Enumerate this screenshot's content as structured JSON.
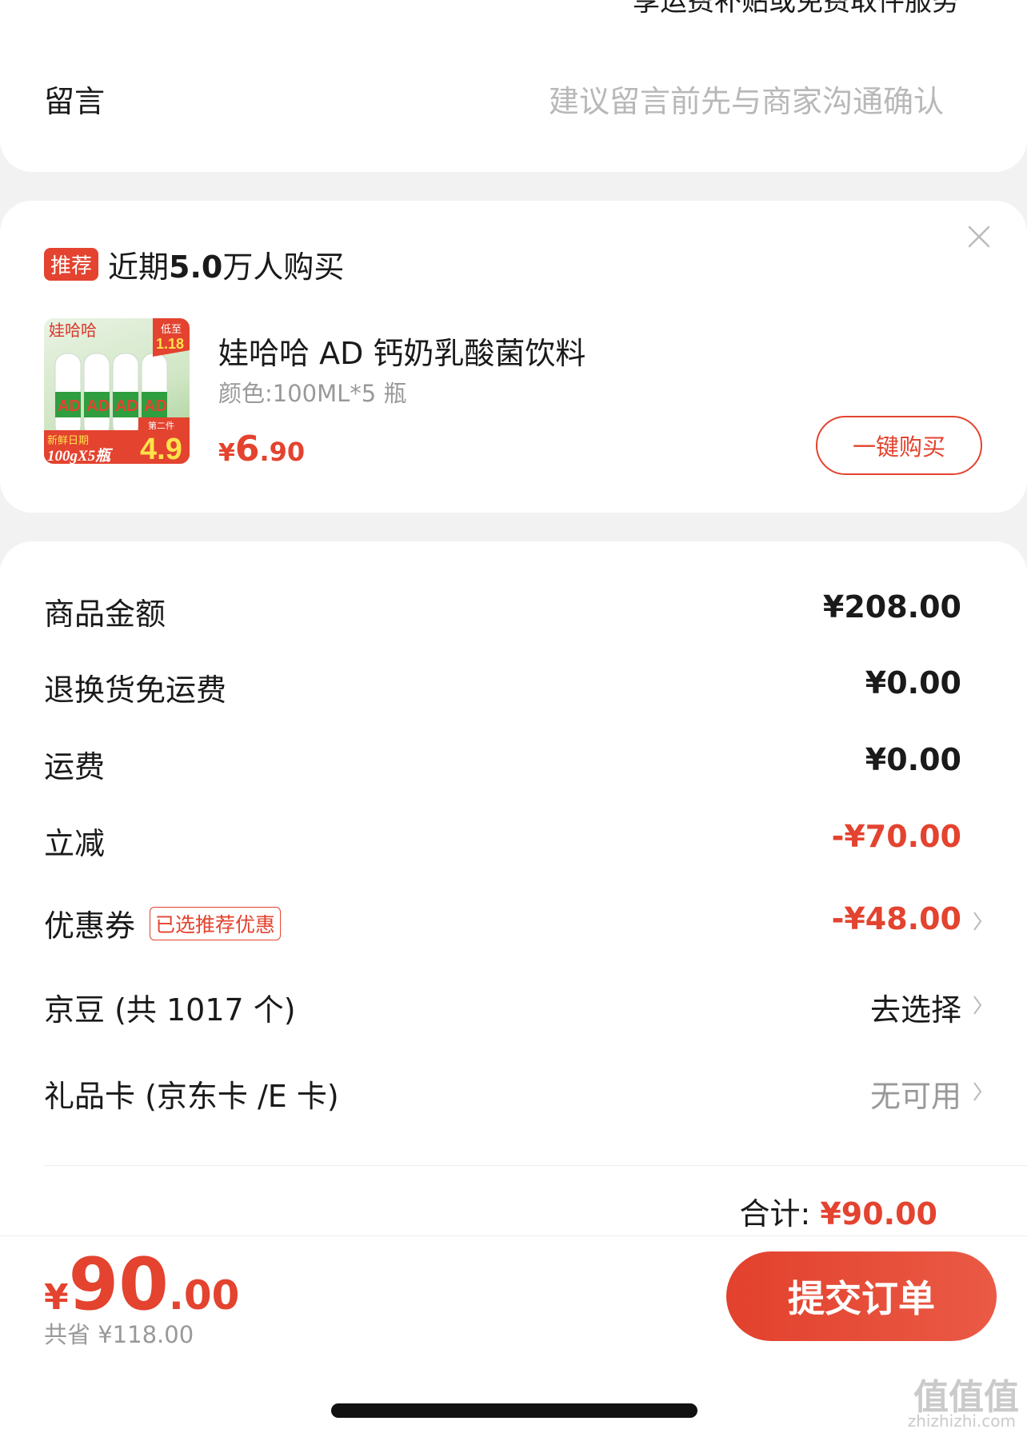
{
  "top_card": {
    "partial_line": "享运费补贴或免费取件服务",
    "note_label": "留言",
    "note_placeholder": "建议留言前先与商家沟通确认"
  },
  "recommend": {
    "badge": "推荐",
    "title_prefix": "近期",
    "title_count": "5.0",
    "title_suffix": "万人购买",
    "product_name": "娃哈哈 AD 钙奶乳酸菌饮料",
    "product_spec": "颜色:100ML*5 瓶",
    "price_currency": "¥",
    "price_int": "6",
    "price_dec": ".90",
    "buy_button": "一键购买",
    "image_texts": {
      "brand": "娃哈哈",
      "low_label": "低至",
      "low_price": "1.18",
      "fresh": "新鲜日期",
      "pack": "100gX5瓶",
      "second": "第二件",
      "big_price": "4.9"
    }
  },
  "summary": {
    "rows": [
      {
        "label": "商品金额",
        "value": "¥208.00"
      },
      {
        "label": "退换货免运费",
        "value": "¥0.00"
      },
      {
        "label": "运费",
        "value": "¥0.00"
      },
      {
        "label": "立减",
        "value": "-¥70.00"
      },
      {
        "label": "优惠券",
        "tag": "已选推荐优惠",
        "value": "-¥48.00"
      },
      {
        "label": "京豆 (共 1017 个)",
        "value": "去选择"
      },
      {
        "label": "礼品卡 (京东卡 /E 卡)",
        "value": "无可用"
      }
    ],
    "subtotal_label": "合计:",
    "subtotal_value": "¥90.00"
  },
  "bottom": {
    "currency": "¥",
    "total_int": "90",
    "total_dec": ".00",
    "saved": "共省 ¥118.00",
    "submit": "提交订单"
  },
  "watermark": {
    "main": "值值值",
    "sub": "zhizhizhi.com"
  },
  "colors": {
    "accent": "#e3432f",
    "background": "#f2f2f2"
  }
}
